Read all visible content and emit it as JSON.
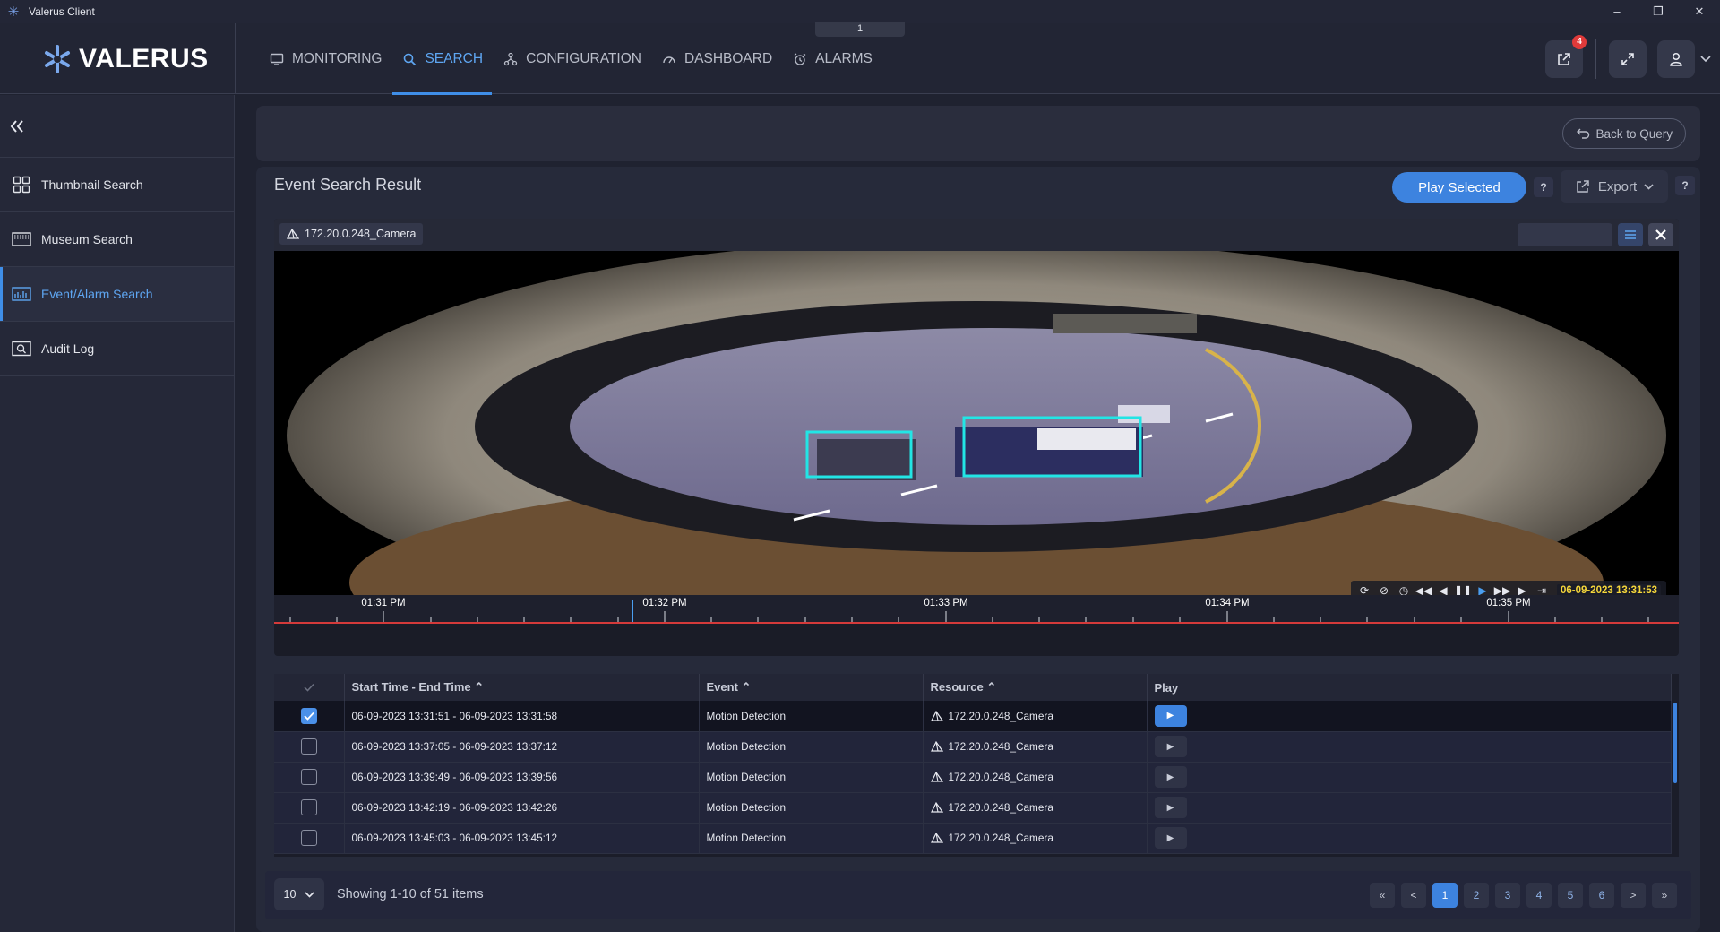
{
  "window": {
    "title": "Valerus Client",
    "tab_indicator": "1",
    "controls": [
      "–",
      "❐",
      "✕"
    ]
  },
  "nav": {
    "logo_text": "VALERUS",
    "items": [
      {
        "label": "MONITORING",
        "icon": "monitor-icon"
      },
      {
        "label": "SEARCH",
        "icon": "search-icon",
        "active": true
      },
      {
        "label": "CONFIGURATION",
        "icon": "configuration-icon"
      },
      {
        "label": "DASHBOARD",
        "icon": "dashboard-icon"
      },
      {
        "label": "ALARMS",
        "icon": "alarm-icon"
      }
    ],
    "notification_count": "4"
  },
  "sidebar": {
    "items": [
      {
        "label": "Thumbnail Search",
        "icon": "thumbnail-grid-icon"
      },
      {
        "label": "Museum Search",
        "icon": "museum-icon"
      },
      {
        "label": "Event/Alarm Search",
        "icon": "event-chart-icon",
        "active": true
      },
      {
        "label": "Audit Log",
        "icon": "audit-log-icon"
      }
    ]
  },
  "query": {
    "back_label": "Back to Query"
  },
  "result": {
    "title": "Event Search Result",
    "play_selected_label": "Play Selected",
    "help_label": "?",
    "export_label": "Export"
  },
  "player": {
    "camera_label": "172.20.0.248_Camera",
    "timestamp": "06-09-2023 13:31:53",
    "timeline_labels": [
      "01:31 PM",
      "01:32 PM",
      "01:33 PM",
      "01:34 PM",
      "01:35 PM"
    ],
    "accent_color": "#f5d63a"
  },
  "table": {
    "headers": {
      "time": "Start Time - End Time",
      "event": "Event",
      "resource": "Resource",
      "play": "Play"
    },
    "rows": [
      {
        "time": "06-09-2023 13:31:51  - 06-09-2023 13:31:58",
        "event": "Motion Detection",
        "resource": "172.20.0.248_Camera",
        "checked": true
      },
      {
        "time": "06-09-2023 13:37:05  - 06-09-2023 13:37:12",
        "event": "Motion Detection",
        "resource": "172.20.0.248_Camera",
        "checked": false
      },
      {
        "time": "06-09-2023 13:39:49  - 06-09-2023 13:39:56",
        "event": "Motion Detection",
        "resource": "172.20.0.248_Camera",
        "checked": false
      },
      {
        "time": "06-09-2023 13:42:19  - 06-09-2023 13:42:26",
        "event": "Motion Detection",
        "resource": "172.20.0.248_Camera",
        "checked": false
      },
      {
        "time": "06-09-2023 13:45:03  - 06-09-2023 13:45:12",
        "event": "Motion Detection",
        "resource": "172.20.0.248_Camera",
        "checked": false
      }
    ]
  },
  "footer": {
    "per_page": "10",
    "showing": "Showing 1-10 of 51 items",
    "pages": [
      "1",
      "2",
      "3",
      "4",
      "5",
      "6"
    ],
    "first": "«",
    "prev": "<",
    "next": ">",
    "last": "»"
  }
}
